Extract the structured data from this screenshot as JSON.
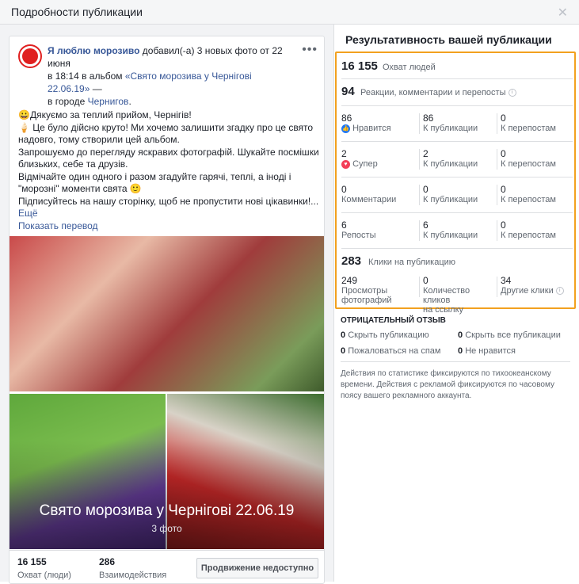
{
  "header": {
    "title": "Подробности публикации"
  },
  "post": {
    "page_name": "Я люблю морозиво",
    "meta_1": " добавил(-а) 3 новых фото от 22 июня",
    "meta_2": "в 18:14 в альбом ",
    "album_link": "«Свято морозива у Чернігові 22.06.19»",
    "meta_3": " —",
    "meta_4": "в городе ",
    "city": "Чернигов",
    "meta_5": ".",
    "text_lines": [
      "😀Дякуємо за теплий прийом, Чернігів!",
      "🍦 Це було дійсно круто! Ми хочемо залишити згадку про це свято",
      "надовго, тому створили цей альбом.",
      "Запрошуємо до перегляду яскравих фотографій. Шукайте посмішки",
      "близьких, себе та друзів.",
      "Відмічайте один одного і разом згадуйте гарячі, теплі, а іноді і",
      "\"морозні\" моменти свята 🙂",
      "Підписуйтесь на нашу сторінку, щоб не пропустити нові цікавинки!..."
    ],
    "more": "Ещё",
    "translate": "Показать перевод",
    "album_title": "Свято морозива у Чернігові 22.06.19",
    "album_count": "3 фото",
    "reach_num": "16 155",
    "reach_lbl": "Охват (люди)",
    "interactions_num": "286",
    "interactions_lbl": "Взаимодействия",
    "promote_btn": "Продвижение недоступно"
  },
  "performance": {
    "title": "Результативность вашей публикации",
    "reach_num": "16 155",
    "reach_lbl": "Охват людей",
    "reactions_num": "94",
    "reactions_lbl": "Реакции, комментарии и перепосты",
    "rows": [
      {
        "c1_num": "86",
        "c1_lbl": "Нравится",
        "c2_num": "86",
        "c2_lbl": "К публикации",
        "c3_num": "0",
        "c3_lbl": "К перепостам"
      },
      {
        "c1_num": "2",
        "c1_lbl": "Супер",
        "c2_num": "2",
        "c2_lbl": "К публикации",
        "c3_num": "0",
        "c3_lbl": "К перепостам"
      },
      {
        "c1_num": "0",
        "c1_lbl": "Комментарии",
        "c2_num": "0",
        "c2_lbl": "К публикации",
        "c3_num": "0",
        "c3_lbl": "К перепостам"
      },
      {
        "c1_num": "6",
        "c1_lbl": "Репосты",
        "c2_num": "6",
        "c2_lbl": "К публикации",
        "c3_num": "0",
        "c3_lbl": "К перепостам"
      }
    ],
    "clicks_num": "283",
    "clicks_lbl": "Клики на публикацию",
    "photo_views_num": "249",
    "photo_views_lbl1": "Просмотры",
    "photo_views_lbl2": "фотографий",
    "link_clicks_num": "0",
    "link_clicks_lbl1": "Количество кликов",
    "link_clicks_lbl2": "на ссылку",
    "other_clicks_num": "34",
    "other_clicks_lbl": "Другие клики"
  },
  "negative": {
    "title": "ОТРИЦАТЕЛЬНЫЙ ОТЗЫВ",
    "hide_post_num": "0",
    "hide_post_lbl": "Скрыть публикацию",
    "hide_all_num": "0",
    "hide_all_lbl": "Скрыть все публикации",
    "spam_num": "0",
    "spam_lbl": "Пожаловаться на спам",
    "unlike_num": "0",
    "unlike_lbl": "Не нравится"
  },
  "note": "Действия по статистике фиксируются по тихоокеанскому времени. Действия с рекламой фиксируются по часовому поясу вашего рекламного аккаунта.",
  "colors": {
    "highlight": "#f2a11f",
    "link": "#385898",
    "like": "#2078f4",
    "love": "#f33e58"
  }
}
